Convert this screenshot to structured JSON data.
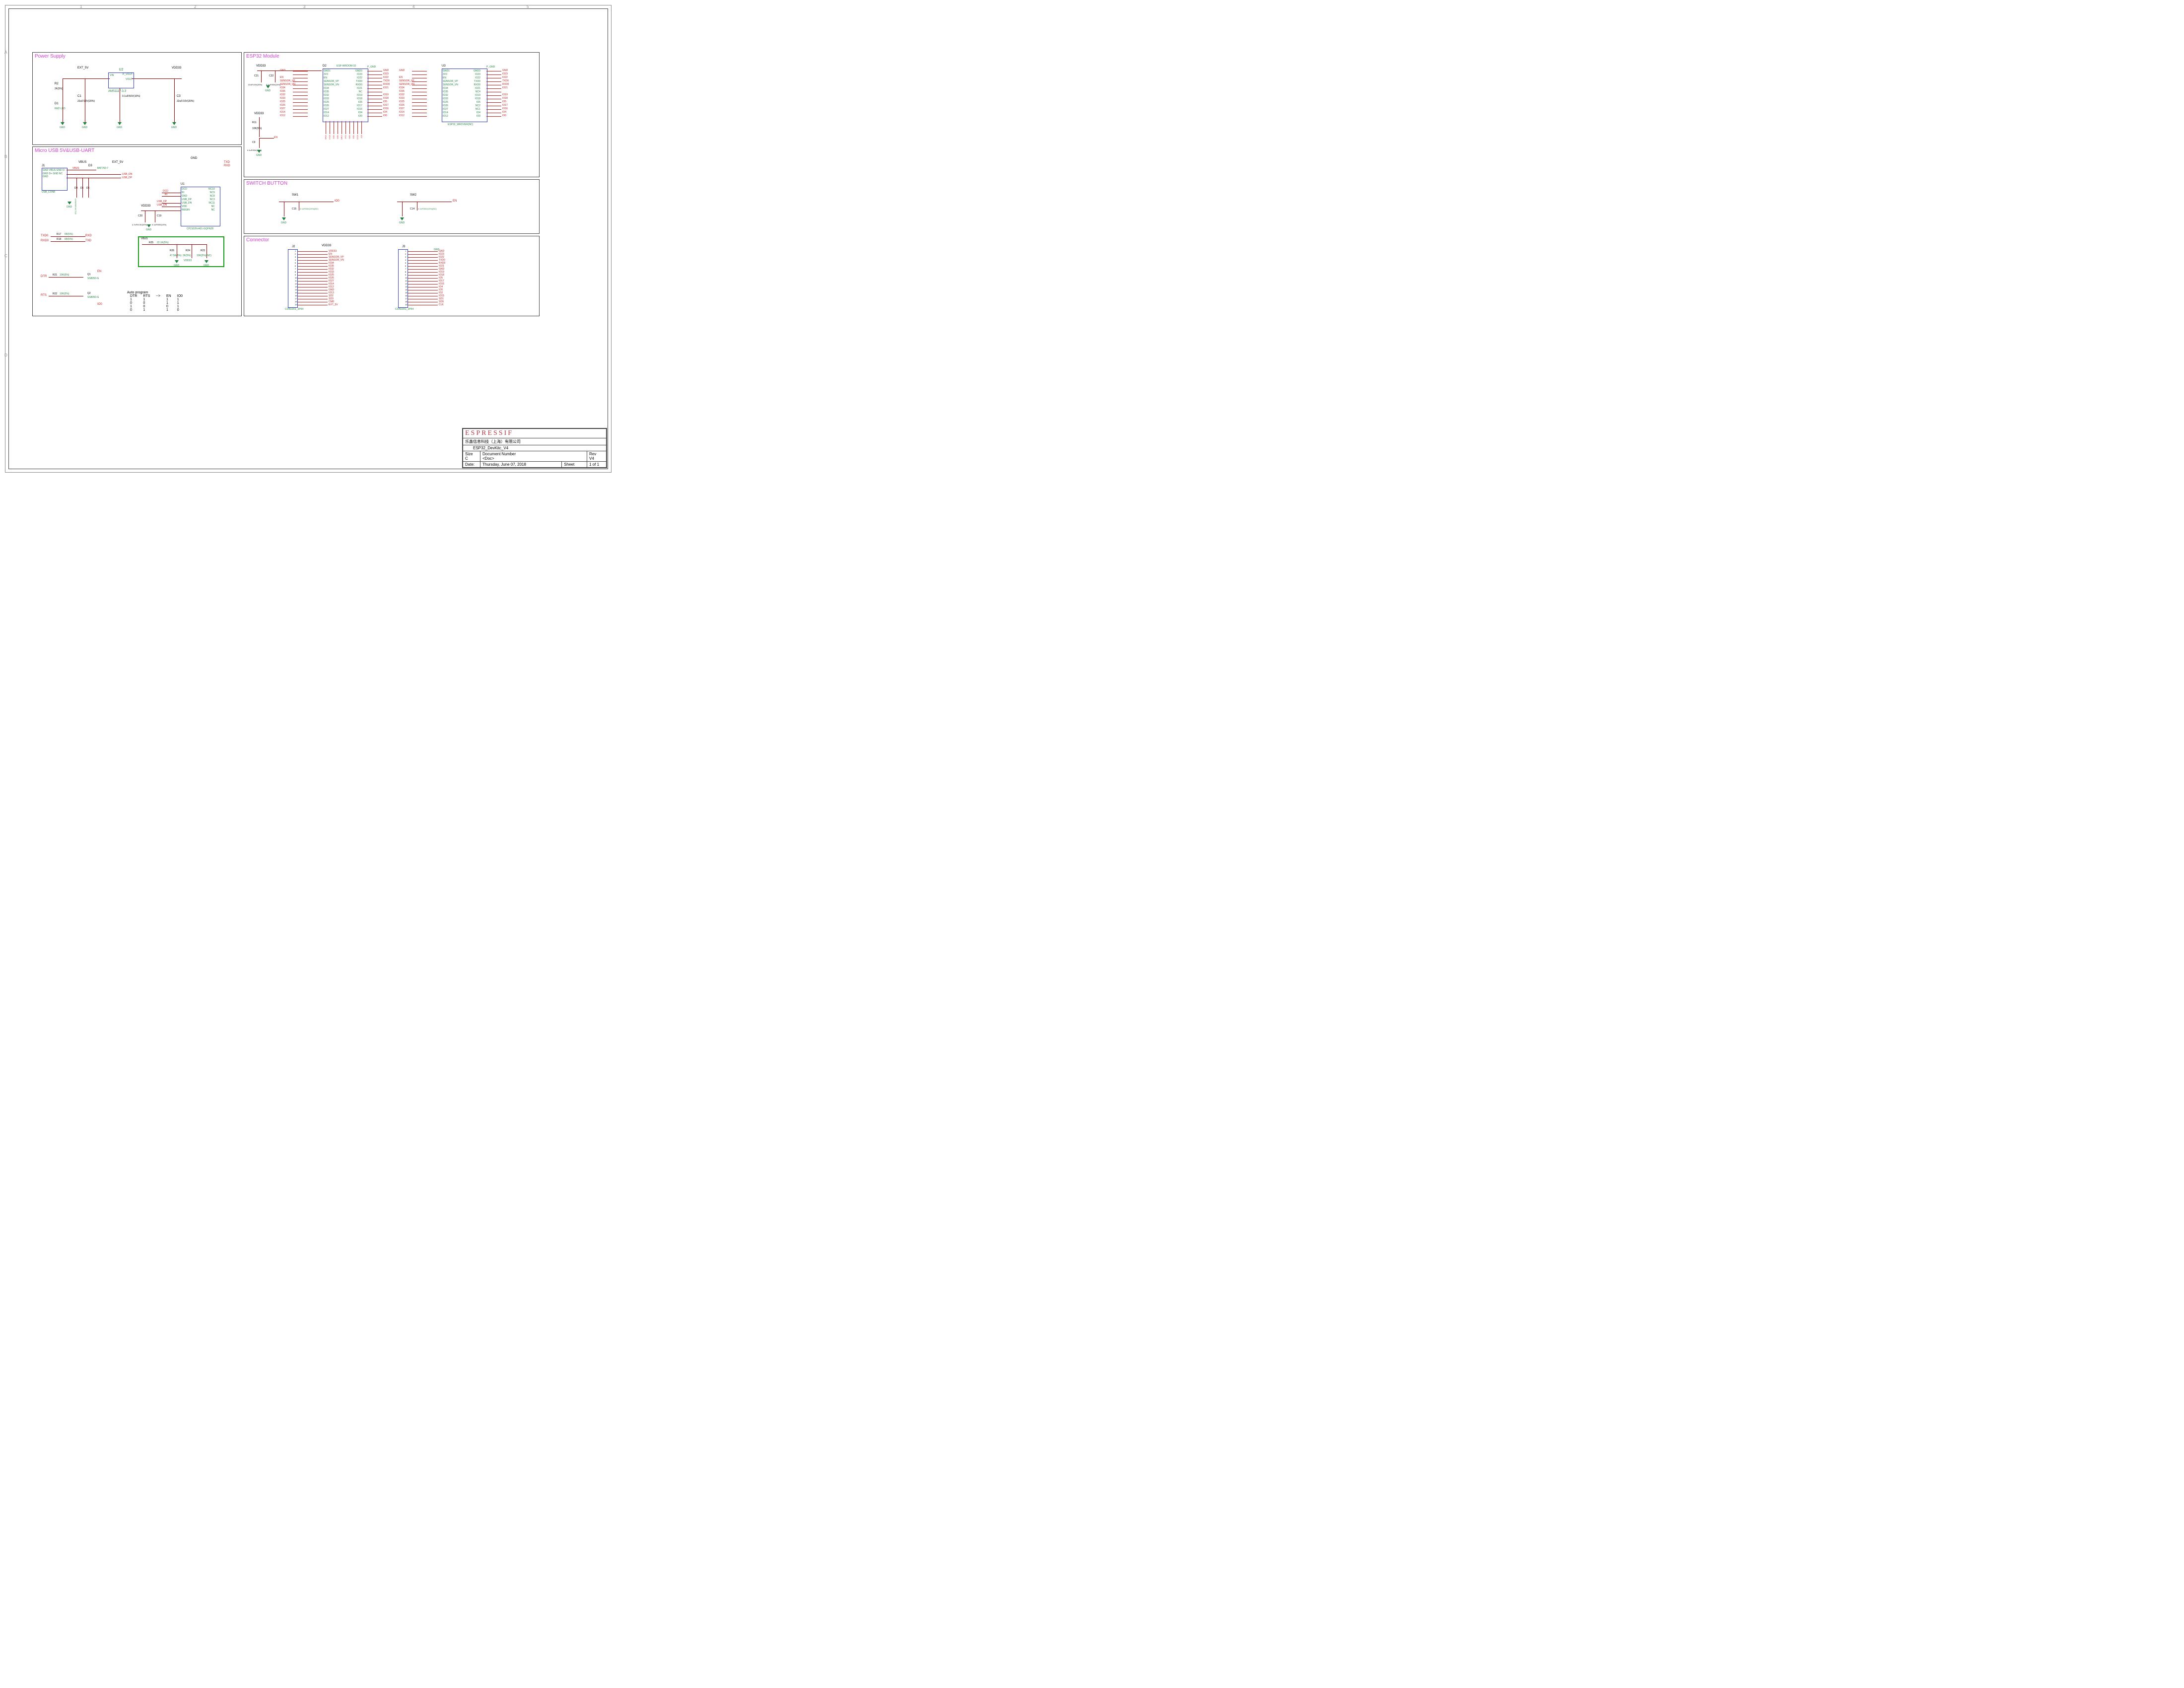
{
  "sheet": {
    "title_block": {
      "company_logo": "ESPRESSIF",
      "company_cn": "乐鑫信息科技（上海）有限公司",
      "title": "ESP32_DevKitc_V4",
      "size_label": "Size",
      "size": "C",
      "docnum_label": "Document  Number",
      "docnum": "<Doc>",
      "rev_label": "Rev",
      "rev": "V4",
      "date_label": "Date:",
      "date": "Thursday, June 07, 2018",
      "sheet_label": "Sheet",
      "sheet_of": "1    of    1"
    }
  },
  "blocks": {
    "power": {
      "title": "Power Supply",
      "nets": {
        "ext5v": "EXT_5V",
        "vdd33": "VDD33",
        "gnd": "GND"
      },
      "u2": {
        "ref": "U2",
        "pn": "AMS1117-3.3",
        "pins": {
          "vin": "VIN",
          "vout": "P_VOUT",
          "vout2": "VOUT",
          "gnd": "GND(fixed)"
        }
      },
      "r2": "R2",
      "r2v": "2K(5%)",
      "d1": "D1",
      "d1v": "RED LED",
      "c1": "C1",
      "c1v": "22uF/10V(20%)",
      "c2": "C2",
      "c2v": "0.1uF/50V(10%)",
      "c3": "C3",
      "c3v": "22uF/10V(20%)"
    },
    "usb": {
      "title": "Micro USB  5V&USB-UART",
      "j1": {
        "ref": "J1",
        "pn": "USB_CON8",
        "pins": [
          "GND",
          "VBUS",
          "GND",
          "D-",
          "GND",
          "D+",
          "GND",
          "NC",
          "GND"
        ]
      },
      "nets": {
        "vbus": "VBUS",
        "ext5v": "EXT_5V",
        "vdd33": "VDD33",
        "gnd": "GND",
        "txd": "TXD",
        "rxd": "RXD",
        "txd0": "TXD0",
        "rxd0": "RXD0",
        "dtr": "DTR",
        "rts": "RTS",
        "en": "EN",
        "io0": "IO0",
        "usb_dn": "USB_DN",
        "usb_dp": "USB_DP",
        "dcd": "DCD",
        "ri": "RI",
        "regin": "REGIN"
      },
      "d3": {
        "ref": "D3",
        "pn": "BAT760-7"
      },
      "d4d5d6": {
        "d4": "D4",
        "d5": "D5",
        "d6": "D6",
        "pn": "LESD5D5.0CT1G"
      },
      "u1": {
        "ref": "U1",
        "pn": "CP2102N-A01-GQFN28",
        "left": [
          "DCD",
          "RI",
          "GND",
          "USB_DP",
          "USB_DN",
          "VDD",
          "REGIN"
        ],
        "top": [
          "VBUS",
          "RSTb",
          "NC1",
          "NC2",
          "SUSPEND",
          "SUSPENDb",
          "CTS"
        ],
        "right": [
          "NC10",
          "NC9",
          "NC8",
          "NC3",
          "NC11",
          "NC",
          "NC"
        ],
        "bottom": [
          "RTS",
          "RXD",
          "TXD",
          "DSR",
          "DTR",
          "GPIO.3",
          "GPIO.2"
        ]
      },
      "c20": "C20",
      "c20v": "4.7uF/6.3V(10%)",
      "c19": "C19",
      "c19v": "0.1uF/50V(10%)",
      "r17": "R17",
      "r17v": "0R(5%)",
      "r18": "R18",
      "r18v": "0R(5%)",
      "r21": "R21",
      "r21v": "10K(5%)",
      "r22": "R22",
      "r22v": "10K(5%)",
      "r25": "R25",
      "r25v": "22.1K(5%)",
      "r26": "R26",
      "r26v": "47.5K(5%)",
      "r24": "R24",
      "r24v": "2K(5%)",
      "r23": "R23",
      "r23v": "10K(5%)(NC)",
      "q1": {
        "ref": "Q1",
        "pn": "SS8050-G"
      },
      "q2": {
        "ref": "Q2",
        "pn": "SS8050-G"
      },
      "autoprog": {
        "title": "Auto program",
        "hdr": [
          "DTR",
          "RTS",
          "-->",
          "EN",
          "IO0"
        ],
        "rows": [
          [
            "1",
            "1",
            "",
            "1",
            "1"
          ],
          [
            "0",
            "0",
            "",
            "1",
            "1"
          ],
          [
            "1",
            "0",
            "",
            "0",
            "1"
          ],
          [
            "0",
            "1",
            "",
            "1",
            "0"
          ]
        ]
      }
    },
    "esp32": {
      "title": "ESP32 Module",
      "d2": {
        "ref": "D2",
        "pn": "ESP-WROOM-32"
      },
      "u3": {
        "ref": "U3",
        "pn": "ESP32_WROVER(NC)"
      },
      "c21": "C21",
      "c21v": "22uF/10V(20%)",
      "c22": "C22",
      "c22v": "0.1uF/50V(10%)",
      "r11": "R11",
      "r11v": "10K(5%)",
      "c9": "C9",
      "c9v": "0.1uF/50V(10%)",
      "nets": {
        "vdd33": "VDD33",
        "gnd": "GND",
        "en": "EN",
        "p_gnd": "P_GND"
      },
      "left_pins": [
        "GND1",
        "3V3",
        "EN",
        "SENSOR_VP",
        "SENSOR_VN",
        "IO34",
        "IO35",
        "IO32",
        "IO33",
        "IO25",
        "IO26",
        "IO27",
        "IO14",
        "IO12"
      ],
      "right_pins": [
        "GND3",
        "IO23",
        "IO22",
        "TXD0",
        "RXD0",
        "IO21",
        "NC",
        "IO19",
        "IO18",
        "IO5",
        "IO17",
        "IO16",
        "IO4",
        "IO0"
      ],
      "bottom_pins": [
        "GND2",
        "IO13",
        "SD2",
        "SD3",
        "CMD",
        "CLK",
        "SD0",
        "SD1",
        "IO15",
        "IO2"
      ],
      "u3_right_pins": [
        "GND3",
        "IO23",
        "IO22",
        "TXD0",
        "RXD0",
        "IO21",
        "NC4",
        "IO19",
        "IO18",
        "IO5",
        "NC2",
        "NC1",
        "IO4",
        "IO0"
      ],
      "side_labels_left": [
        "GND",
        "",
        "EN",
        "SENSOR_VP",
        "SENSOR_VN",
        "IO34",
        "IO35",
        "IO32",
        "IO33",
        "IO25",
        "IO26",
        "IO27",
        "IO14",
        "IO12"
      ],
      "side_labels_right": [
        "GND",
        "IO23",
        "IO22",
        "TXD0",
        "RXD0",
        "IO21",
        "",
        "IO19",
        "IO18",
        "IO5",
        "IO17",
        "IO16",
        "IO4",
        "IO0"
      ],
      "side_labels_right_u3": [
        "GND",
        "IO23",
        "IO22",
        "TXD0",
        "RXD0",
        "IO21",
        "",
        "IO19",
        "IO18",
        "IO5",
        "IO17",
        "IO16",
        "IO4",
        "IO0"
      ],
      "bottom_labels": [
        "GND",
        "IO13",
        "SD2",
        "SD3",
        "CMD",
        "CLK",
        "SD0",
        "SD1",
        "IO15",
        "IO2"
      ]
    },
    "switch": {
      "title": "SWITCH BUTTON",
      "sw1": {
        "ref": "SW1",
        "net": "IO0"
      },
      "sw2": {
        "ref": "SW2",
        "net": "EN"
      },
      "c15": "C15",
      "c15v": "0.1uF/50V(10%)(NC)",
      "c14": "C14",
      "c14v": "0.1uF/50V(10%)(NC)",
      "gnd": "GND"
    },
    "connector": {
      "title": "Connector",
      "j2": {
        "ref": "J2",
        "pn": "CON19X1_2P54",
        "labels": [
          "VDD33",
          "EN",
          "SENSOR_VP",
          "SENSOR_VN",
          "IO34",
          "IO35",
          "IO32",
          "IO33",
          "IO25",
          "IO26",
          "IO27",
          "IO14",
          "IO12",
          "GND",
          "IO13",
          "SD2",
          "SD3",
          "CMD",
          "EXT_5V"
        ]
      },
      "j3": {
        "ref": "J3",
        "pn": "CON19X1_2P54",
        "labels": [
          "GND",
          "IO23",
          "IO22",
          "TXD0",
          "RXD0",
          "IO21",
          "GND",
          "IO19",
          "IO18",
          "IO5",
          "IO17",
          "IO16",
          "IO4",
          "IO0",
          "IO2",
          "IO15",
          "SD1",
          "SD0",
          "CLK"
        ]
      }
    }
  }
}
